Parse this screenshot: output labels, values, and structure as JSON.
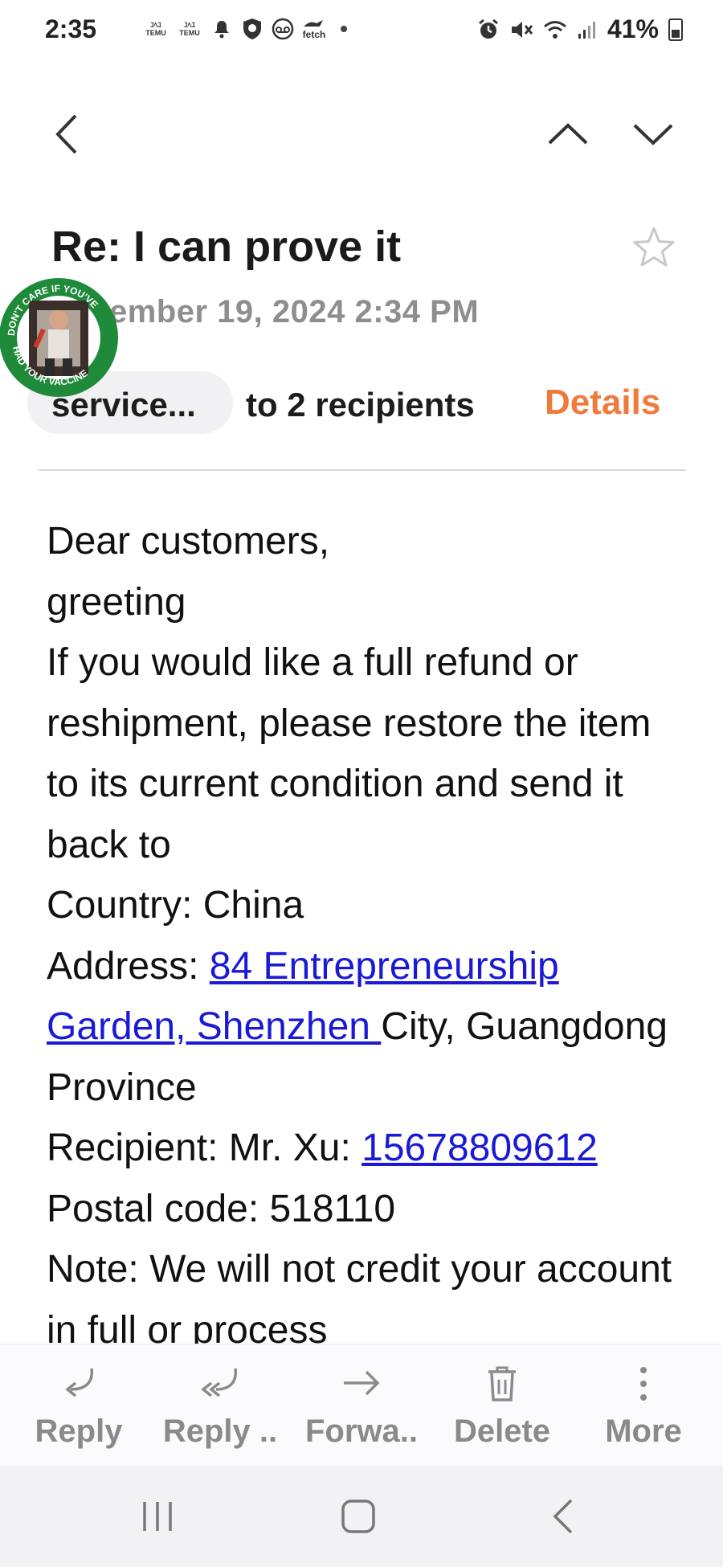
{
  "status_bar": {
    "time": "2:35",
    "temu_label_1": "TEMU",
    "temu_label_2": "TEMU",
    "fetch_label": "fetch",
    "battery_percent": "41%"
  },
  "header": {
    "subject": "Re: I can prove it",
    "date": "ember 19, 2024  2:34 PM",
    "sender": "service...",
    "recipients": "to 2 recipients",
    "details_label": "Details",
    "sticker_text_top": "DON'T CARE IF YOU'VE",
    "sticker_text_bottom": "HAD YOUR VACCINE"
  },
  "body": {
    "line1": "Dear customers,",
    "line2": "greeting",
    "line3": "If you would like a full refund or reshipment, please restore the item to its current condition and send it back to",
    "country": "Country: China",
    "address_prefix": "Address: ",
    "address_link": "84 Entrepreneurship Garden, Shenzhen ",
    "address_suffix": "City, Guangdong Province",
    "recipient_prefix": "Recipient: Mr. Xu: ",
    "phone_link": "15678809612",
    "postal": "Postal code: 518110",
    "note": "Note: We will not credit your account in full or process"
  },
  "actions": [
    {
      "label": "Reply",
      "icon": "reply-icon"
    },
    {
      "label": "Reply ..",
      "icon": "reply-all-icon"
    },
    {
      "label": "Forwa..",
      "icon": "forward-icon"
    },
    {
      "label": "Delete",
      "icon": "trash-icon"
    },
    {
      "label": "More",
      "icon": "more-vertical-icon"
    }
  ],
  "colors": {
    "accent": "#f07a3c",
    "link": "#1a1ad6",
    "muted": "#8e8e8e",
    "sticker_green": "#1f8a3a"
  }
}
